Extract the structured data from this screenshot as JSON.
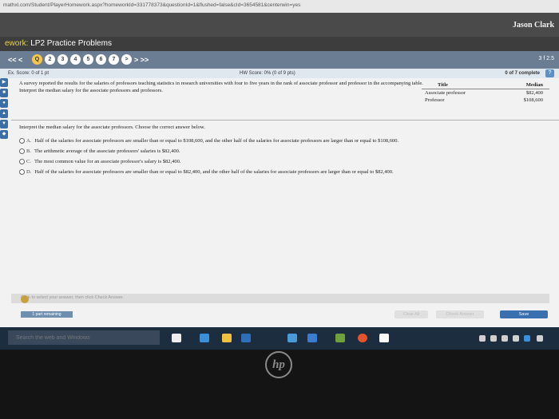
{
  "browser": {
    "url": "mathxl.com/Student/PlayerHomework.aspx?homeworkId=331778373&questionId=1&flushed=false&cId=3654581&centerwin=yes"
  },
  "header": {
    "user_name": "Jason Clark"
  },
  "homework": {
    "title_prefix": "ework:",
    "title": "LP2 Practice Problems"
  },
  "nav": {
    "prev": "<<  <",
    "next": ">  >>",
    "question_count": "3 f 2.5",
    "questions": [
      "Q",
      "2",
      "3",
      "4",
      "5",
      "6",
      "7",
      ">"
    ]
  },
  "score": {
    "ex_score": "Ex. Score: 0 of 1 pt",
    "hw_score": "HW Score: 0% (0 of 9 pts)",
    "complete": "0 of 7 complete",
    "help": "?"
  },
  "problem": {
    "text": "A survey reported the results for the salaries of professors teaching statistics in research universities with four to five years in the rank of associate professor and professor in the accompanying table. Interpret the median salary for the associate professors and professors.",
    "table": {
      "headers": [
        "Title",
        "Median"
      ],
      "rows": [
        [
          "Associate professor",
          "$82,400"
        ],
        [
          "Professor",
          "$108,600"
        ]
      ]
    },
    "instruction": "Interpret the median salary for the associate professors.  Choose the correct answer below.",
    "answers": [
      {
        "letter": "A.",
        "text": "Half of the salaries for associate professors are smaller than or equal to $108,600, and the other half of the salaries for associate professors are larger than or equal to $108,600."
      },
      {
        "letter": "B.",
        "text": "The arithmetic average of the associate professors' salaries is $82,400."
      },
      {
        "letter": "C.",
        "text": "The most common value for an associate professor's salary is $82,400."
      },
      {
        "letter": "D.",
        "text": "Half of the salaries for associate professors are smaller than or equal to $82,400, and the other half of the salaries for associate professors are larger than or equal to $82,400."
      }
    ]
  },
  "footer": {
    "hint": "Click to select your answer, then click Check Answer.",
    "info": "?",
    "parts_remaining": "1 part remaining",
    "clear_all": "Clear All",
    "check_answer": "Check Answer",
    "save": "Save"
  },
  "taskbar": {
    "search_placeholder": "Search the web and Windows",
    "icons": [
      "task-view-icon",
      "edge-icon",
      "file-explorer-icon",
      "store-icon",
      "mail-icon",
      "photos-icon",
      "app-icon",
      "chrome-icon",
      "ideas-icon"
    ],
    "icon_colors": [
      "#eeeeee",
      "#3a8fd8",
      "#f0c040",
      "#2f6eb8",
      "#4a9ad8",
      "#3b7bd0",
      "#6fa03a",
      "#e5532d",
      "#ffffff"
    ]
  },
  "device": {
    "brand": "hp"
  }
}
